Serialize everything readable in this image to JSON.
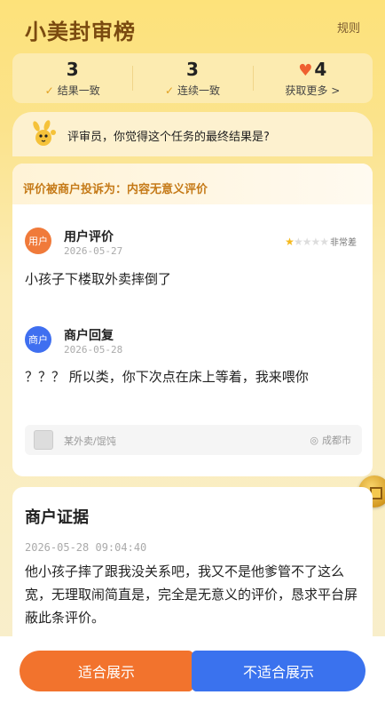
{
  "header": {
    "title": "小美封审榜",
    "rules_label": "规则"
  },
  "stats": [
    {
      "value": "3",
      "label": "结果一致",
      "icon": "check-icon"
    },
    {
      "value": "3",
      "label": "连续一致",
      "icon": "check-icon"
    },
    {
      "value": "4",
      "label": "获取更多 >",
      "icon": "heart-icon"
    }
  ],
  "question": {
    "text": "评审员，你觉得这个任务的最终结果是?"
  },
  "complaint": {
    "text": "评价被商户投诉为：内容无意义评价"
  },
  "user_review": {
    "avatar_label": "用户",
    "name": "用户评价",
    "date": "2026-05-27",
    "rating": 1,
    "rating_max": 5,
    "rating_text": "非常差",
    "body": "小孩子下楼取外卖摔倒了"
  },
  "merchant_reply": {
    "avatar_label": "商户",
    "name": "商户回复",
    "date": "2026-05-28",
    "body": "？？？ 所以类，你下次点在床上等着，我来喂你"
  },
  "store": {
    "name": "某外卖/馄饨",
    "city": "成都市"
  },
  "evidence": {
    "title": "商户证据",
    "datetime": "2026-05-28 09:04:40",
    "body": "他小孩子摔了跟我没关系吧，我又不是他爹管不了这么宽，无理取闹简直是，完全是无意义的评价，恳求平台屏蔽此条评价。"
  },
  "actions": {
    "suitable": "适合展示",
    "unsuitable": "不适合展示"
  },
  "colors": {
    "accent_orange": "#f2732d",
    "accent_blue": "#3a72ee",
    "complaint_text": "#c57a18"
  }
}
